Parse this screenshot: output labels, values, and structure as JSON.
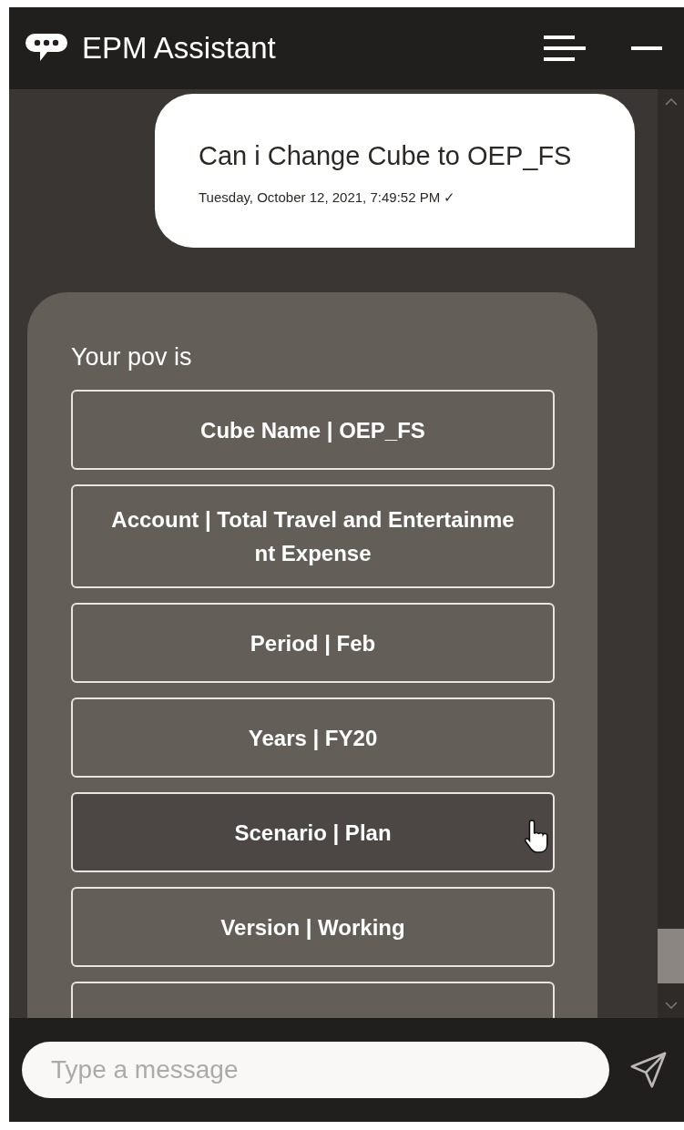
{
  "window": {
    "title": "EPM Assistant"
  },
  "user_message": {
    "text": "Can i Change Cube to OEP_FS",
    "timestamp": "Tuesday, October 12, 2021, 7:49:52 PM ✓"
  },
  "bot_message": {
    "text": "Your pov is",
    "options": [
      {
        "label": "Cube Name | OEP_FS",
        "hovered": false
      },
      {
        "label": "Account | Total Travel and Entertainment Expense",
        "hovered": false
      },
      {
        "label": "Period | Feb",
        "hovered": false
      },
      {
        "label": "Years | FY20",
        "hovered": false
      },
      {
        "label": "Scenario | Plan",
        "hovered": true
      },
      {
        "label": "Version | Working",
        "hovered": false
      }
    ]
  },
  "composer": {
    "placeholder": "Type a message"
  }
}
